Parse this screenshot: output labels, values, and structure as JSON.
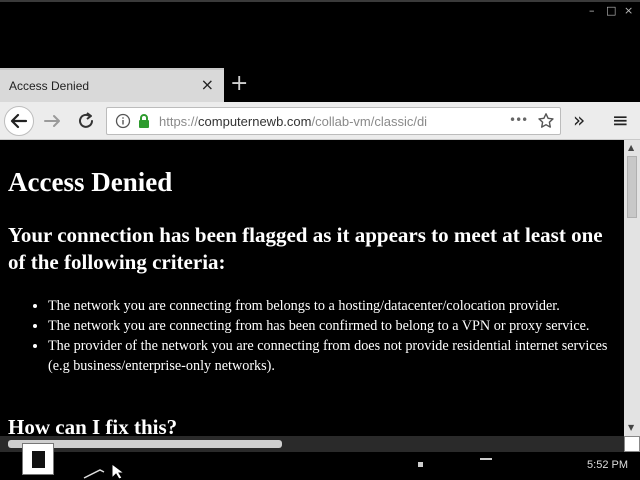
{
  "tab": {
    "title": "Access Denied",
    "close_icon": "×",
    "new_tab_icon": "+"
  },
  "window": {
    "minimize": "–",
    "maximize": "□",
    "close": "×"
  },
  "urlbar": {
    "scheme": "https://",
    "host": "computernewb.com",
    "path": "/collab-vm/classic/di",
    "more": "•••"
  },
  "overflow_icon": "»",
  "menu_icon": "≡",
  "page": {
    "heading": "Access Denied",
    "subheading": "Your connection has been flagged as it appears to meet at least one of the following criteria:",
    "criteria": [
      "The network you are connecting from belongs to a hosting/datacenter/colocation provider.",
      "The network you are connecting from has been confirmed to belong to a VPN or proxy service.",
      "The provider of the network you are connecting from does not provide residential internet services (e.g business/enterprise-only networks)."
    ],
    "fix_heading": "How can I fix this?"
  },
  "taskbar": {
    "clock": "5:52 PM"
  },
  "colors": {
    "page_bg": "#000000",
    "text": "#ffffff",
    "toolbar": "#ececec",
    "lock_green": "#2e9b2e"
  }
}
